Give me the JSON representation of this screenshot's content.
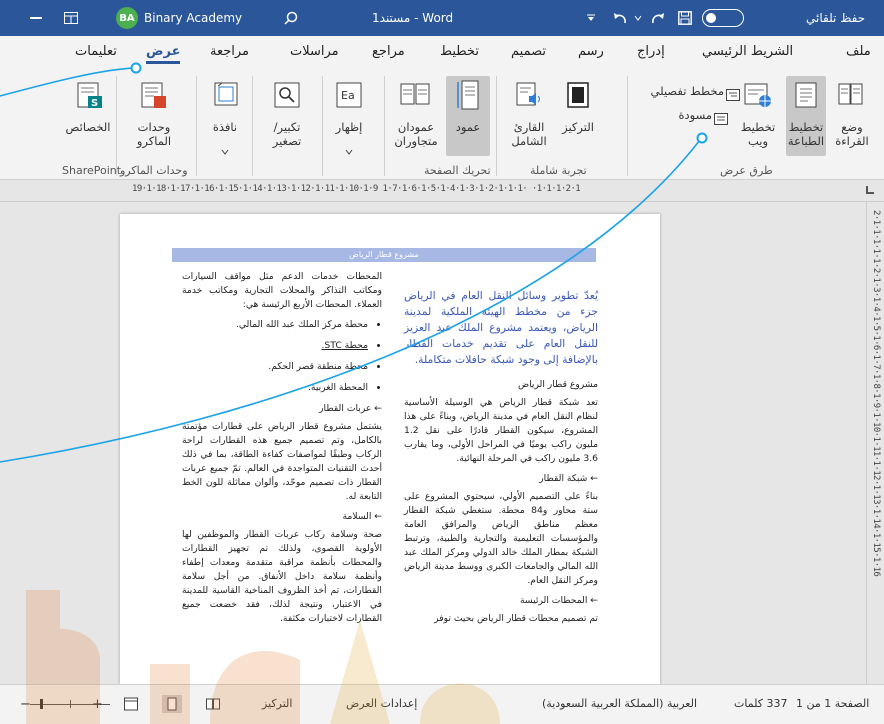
{
  "titlebar": {
    "autosave_label": "حفظ تلقائي",
    "doc_title": "مستند1 - Word",
    "user_initials": "BA",
    "user_name": "Binary Academy"
  },
  "tabs": [
    {
      "label": "ملف"
    },
    {
      "label": "الشريط الرئيسي"
    },
    {
      "label": "إدراج"
    },
    {
      "label": "رسم"
    },
    {
      "label": "تصميم"
    },
    {
      "label": "تخطيط"
    },
    {
      "label": "مراجع"
    },
    {
      "label": "مراسلات"
    },
    {
      "label": "مراجعة"
    },
    {
      "label": "عرض",
      "active": true
    },
    {
      "label": "تعليمات"
    }
  ],
  "ribbon": {
    "views": {
      "read_mode": "وضع القراءة",
      "print_layout": "تخطيط الطباعة",
      "web_layout": "تخطيط ويب",
      "outline": "مخطط تفصيلي",
      "draft": "مسودة",
      "group": "طرق عرض"
    },
    "immersive": {
      "focus": "التركيز",
      "immersive_reader": "القارئ الشامل",
      "group": "تجربة شاملة"
    },
    "page_movement": {
      "vertical": "عمود",
      "side_by_side": "عمودان متجاوران",
      "group": "تحريك الصفحة"
    },
    "show": "إظهار",
    "zoom": "تكبير/ تصغير",
    "window": "نافذة",
    "macros": {
      "label": "وحدات الماكرو",
      "group": "وحدات الماكرو"
    },
    "sharepoint": {
      "label": "الخصائص",
      "group": "SharePoint"
    }
  },
  "ruler": {
    "horizontal": "19·1·18·1·17·1·16·1·15·1·14·1·13·1·12·1·11·1·10·1·9  1·7·1·6·1·5·1·4·1·3·1·2·1·1·1·  ·1·1·1·2·1",
    "vertical": "2·1·1·1·1·1·2·1·3·1·4·1·5·1·6·1·7·1·8·1·9·1·10·1·11·1·12·1·13·1·14·1·15·1·16"
  },
  "document": {
    "banner": "مشروع قطار الرياض",
    "right_col": {
      "intro": "يُعدّ تطوير وسائل النقل العام في الرياض جزء من مخطط الهيئة الملكية لمدينة الرياض، ويعتمد مشروع الملك عبد العزيز للنقل العام على تقديم خدمات القطار بالإضافة إلى وجود شبكة حافلات متكاملة.",
      "h1": "مشروع قطار الرياض",
      "p1": "تعد شبكة قطار الرياض هي الوسيلة الأساسية لنظام النقل العام في مدينة الرياض، وبناءً على هذا المشروع، سيكون القطار قادرًا على نقل 1.2 مليون راكب يوميًا في المراحل الأولى، وما يقارب 3.6 مليون راكب في المرحلة النهائية.",
      "h2": "← شبكة القطار",
      "p2": "بناءً على التصميم الأولي، سيحتوي المشروع على ستة محاور و84 محطة. ستغطي شبكة القطار معظم مناطق الرياض والمرافق العامة والمؤسسات التعليمية والتجارية والطبية، وترتبط الشبكة بمطار الملك خالد الدولي ومركز الملك عبد الله المالي والجامعات الكبرى ووسط مدينة الرياض ومركز النقل العام.",
      "h3": "← المحطات الرئيسة",
      "p3": "تم تصميم محطات قطار الرياض بحيث توفر"
    },
    "left_col": {
      "p0": "المحطات خدمات الدعم مثل مواقف السيارات ومكاتب التذاكر والمحلات التجارية ومكاتب خدمة العملاء. المحطات الأربع الرئيسة هي:",
      "b1": "محطة مركز الملك عبد الله المالي.",
      "b2": "محطة STC.",
      "b3": "محطة منطقة قصر الحكم.",
      "b4": "المحطة الغربية.",
      "h1": "← عربات القطار",
      "p1": "يشتمل مشروع قطار الرياض على قطارات مؤتمتة بالكامل، وتم تصميم جميع هذه القطارات لراحة الركاب وطبقًا لمواصفات كفاءة الطاقة، بما في ذلك أحدث التقنيات المتواجدة في العالم. تمّ جميع عربات القطار ذات تصميم موحّد، وألوان مماثلة للون الخط التابعة له.",
      "h2": "← السلامة",
      "p2": "صحة وسلامة ركاب عربات القطار والموظفين لها الأولوية القصوى، ولذلك تم تجهيز القطارات والمحطات بأنظمة مراقبة متقدمة ومعدات إطفاء وأنظمة سلامة داخل الأنفاق. من أجل سلامة القطارات، تم أخذ الظروف المناخية القاسية للمدينة في الاعتبار، ونتيجة لذلك، فقد خضعت جميع القطارات لاختبارات مكثفة."
    }
  },
  "status": {
    "page": "الصفحة 1 من 1",
    "words": "337 كلمات",
    "language": "العربية (المملكة العربية السعودية)",
    "display_settings": "إعدادات العرض",
    "focus": "التركيز"
  },
  "colors": {
    "brand": "#2b579a",
    "annotation_line": "#1aa3e8",
    "banner": "#a8b8e4",
    "intro_text": "#3b58b8"
  }
}
